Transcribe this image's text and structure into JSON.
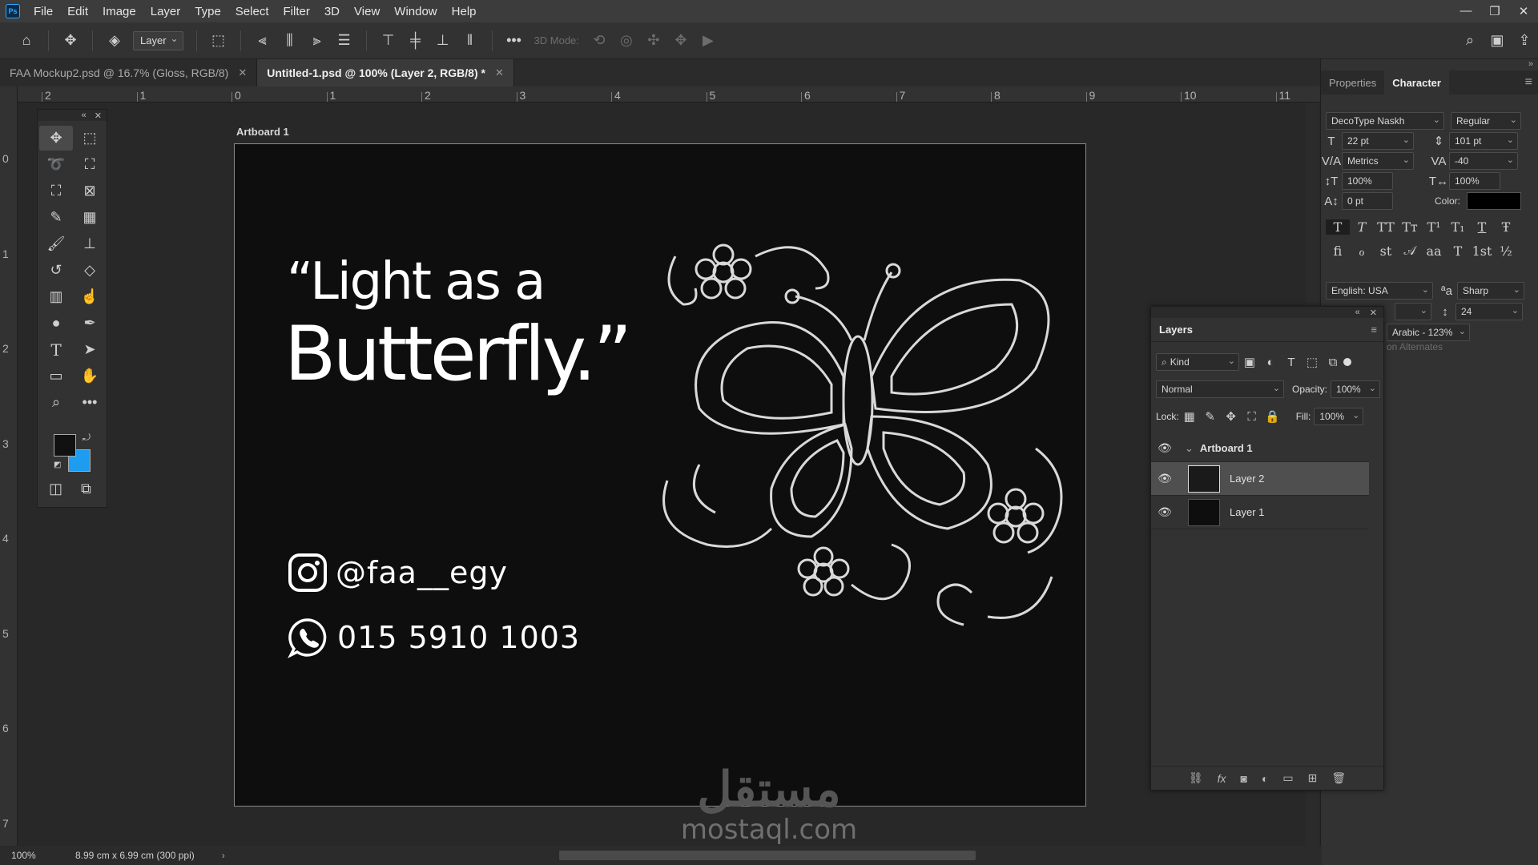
{
  "app": {
    "logo": "Ps"
  },
  "menu": [
    "File",
    "Edit",
    "Image",
    "Layer",
    "Type",
    "Select",
    "Filter",
    "3D",
    "View",
    "Window",
    "Help"
  ],
  "window_controls": {
    "minimize": "—",
    "restore": "❐",
    "close": "✕"
  },
  "options_bar": {
    "layer_select": "Layer",
    "mode_label": "3D Mode:"
  },
  "tabs": [
    {
      "label": "FAA Mockup2.psd @ 16.7% (Gloss, RGB/8)",
      "active": false
    },
    {
      "label": "Untitled-1.psd @ 100% (Layer 2, RGB/8) *",
      "active": true
    }
  ],
  "ruler_top": [
    "2",
    "1",
    "0",
    "1",
    "2",
    "3",
    "4",
    "5",
    "6",
    "7",
    "8",
    "9",
    "10",
    "11"
  ],
  "ruler_left": [
    "0",
    "1",
    "2",
    "3",
    "4",
    "5",
    "6",
    "7"
  ],
  "artboard": {
    "label": "Artboard 1",
    "quote_line1": "“Light as a",
    "quote_line2": "Butterfly.”",
    "instagram": "@faa__egy",
    "phone": "015 5910 1003"
  },
  "watermark": {
    "arabic": "مستقل",
    "latin": "mostaql.com"
  },
  "colors": {
    "foreground": "#111111",
    "background": "#1e9cf0",
    "accent": "#31a8ff",
    "artboard_bg": "#0e0e0e"
  },
  "tools": [
    "move-icon",
    "marquee-icon",
    "lasso-icon",
    "object-select-icon",
    "crop-icon",
    "frame-icon",
    "eyedropper-icon",
    "patch-icon",
    "brush-icon",
    "stamp-icon",
    "history-brush-icon",
    "eraser-icon",
    "gradient-icon",
    "smudge-icon",
    "dodge-icon",
    "pen-icon",
    "type-icon",
    "path-select-icon",
    "shape-icon",
    "hand-icon",
    "zoom-icon",
    "more-tools-icon",
    "quickmask-icon",
    "screen-mode-icon"
  ],
  "right_panel": {
    "tabs": [
      "Properties",
      "Character"
    ],
    "font_family": "DecoType Naskh",
    "font_style": "Regular",
    "font_size": "22 pt",
    "leading": "101 pt",
    "kerning": "Metrics",
    "tracking": "-40",
    "vertical_scale": "100%",
    "horizontal_scale": "100%",
    "baseline_shift": "0 pt",
    "color_label": "Color:",
    "language": "English: USA",
    "antialias": "Sharp",
    "diacritic_value": "24",
    "digits": "Arabic - 123%",
    "alternates": "on Alternates",
    "type_styles": [
      "T",
      "T",
      "TT",
      "Tᴛ",
      "T¹",
      "T₁",
      "T",
      "Ŧ"
    ],
    "opentype": [
      "fi",
      "ℴ",
      "st",
      "𝒜",
      "aa",
      "T",
      "1st",
      "½"
    ]
  },
  "layers_panel": {
    "title": "Layers",
    "filter": "Kind",
    "blend_mode": "Normal",
    "opacity_label": "Opacity:",
    "opacity": "100%",
    "lock_label": "Lock:",
    "fill_label": "Fill:",
    "fill": "100%",
    "group": "Artboard 1",
    "layers": [
      {
        "name": "Layer 2",
        "selected": true
      },
      {
        "name": "Layer 1",
        "selected": false
      }
    ]
  },
  "status": {
    "zoom": "100%",
    "doc_info": "8.99 cm x 6.99 cm (300 ppi)"
  }
}
